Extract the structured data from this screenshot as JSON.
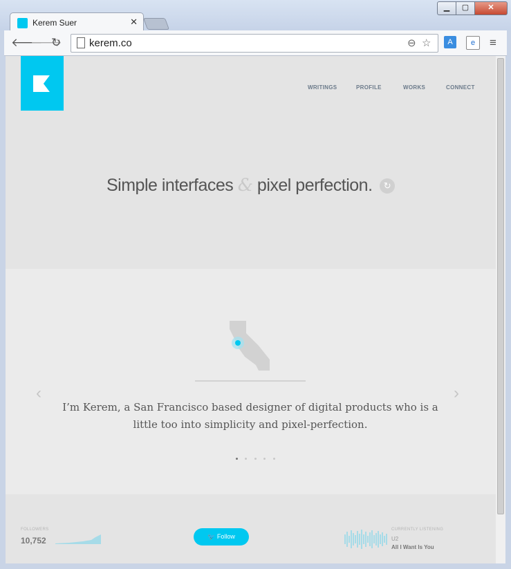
{
  "browser": {
    "tab_title": "Kerem Suer",
    "url": "kerem.co",
    "colors": {
      "favicon": "#00c8f0"
    }
  },
  "site": {
    "nav": [
      "WRITINGS",
      "PROFILE",
      "WORKS",
      "CONNECT"
    ],
    "hero": {
      "part1": "Simple interfaces",
      "amp": "&",
      "part2": "pixel perfection."
    },
    "bio": "I’m Kerem, a San Francisco based designer of digital products who is a little too into simplicity and pixel-perfection.",
    "carousel": {
      "count": 5,
      "active_index": 0
    },
    "footer": {
      "followers_label": "FOLLOWERS",
      "followers_count": "10,752",
      "follow_label": "Follow",
      "listening_label": "CURRENTLY LISTENING",
      "artist": "U2",
      "track": "All I Want Is You"
    },
    "colors": {
      "accent": "#00c8f0",
      "page_bg": "#e4e4e4",
      "band_bg": "#ebebeb"
    }
  }
}
